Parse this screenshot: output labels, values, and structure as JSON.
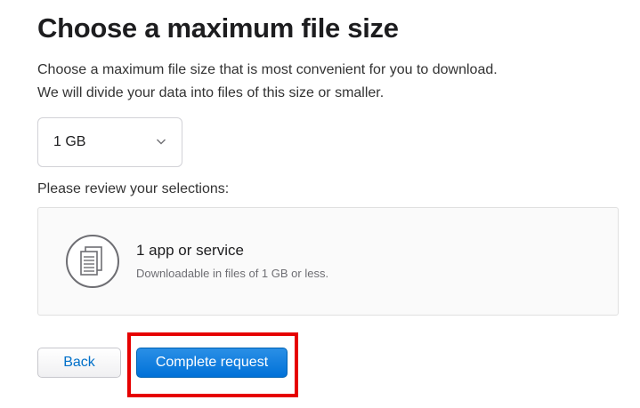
{
  "heading": {
    "title": "Choose a maximum file size",
    "description_line1": "Choose a maximum file size that is most convenient for you to download.",
    "description_line2": "We will divide your data into files of this size or smaller."
  },
  "size_select": {
    "selected": "1 GB",
    "icon": "chevron-down-icon"
  },
  "review": {
    "label": "Please review your selections:",
    "item_title": "1 app or service",
    "item_subtitle": "Downloadable in files of 1 GB or less.",
    "icon": "documents-icon"
  },
  "actions": {
    "back_label": "Back",
    "complete_label": "Complete request"
  },
  "colors": {
    "primary_button": "#0071d8",
    "link_text": "#0070c9",
    "highlight_border": "#e60000"
  }
}
